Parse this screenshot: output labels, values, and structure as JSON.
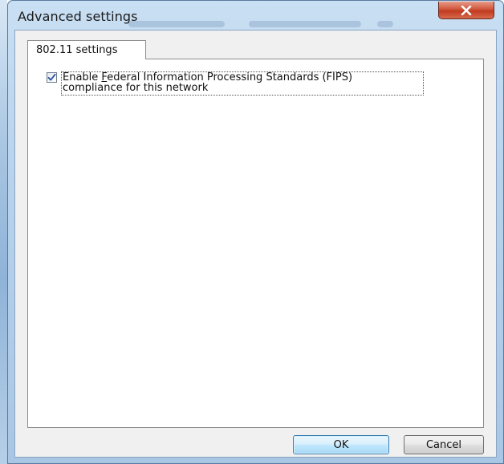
{
  "window": {
    "title": "Advanced settings"
  },
  "tabs": [
    {
      "label": "802.11 settings",
      "selected": true
    }
  ],
  "fips": {
    "checked": true,
    "label_prefix": "Enable ",
    "label_accel": "F",
    "label_rest_line1": "ederal Information Processing Standards (FIPS)",
    "label_line2": "compliance for this network"
  },
  "buttons": {
    "ok": "OK",
    "cancel": "Cancel"
  },
  "colors": {
    "title_bar": "#b8d2ec",
    "close_button": "#c0391f",
    "default_button_border": "#3c7fb1"
  }
}
